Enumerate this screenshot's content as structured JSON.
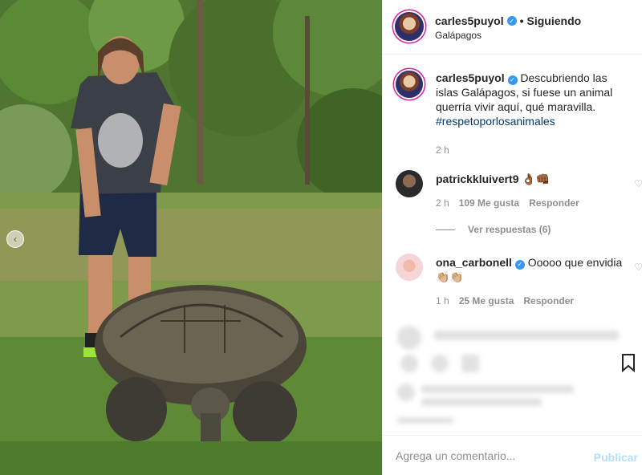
{
  "header": {
    "username": "carles5puyol",
    "follow_label": "Siguiendo",
    "location": "Galápagos"
  },
  "caption": {
    "username": "carles5puyol",
    "text": "Descubriendo las islas Galápagos, si fuese un animal querría vivir aquí, qué maravilla.",
    "hashtag": "#respetoporlosanimales",
    "time": "2 h"
  },
  "comments": [
    {
      "username": "patrickkluivert9",
      "text": "👌🏾👊🏾",
      "time": "2 h",
      "likes": "109 Me gusta",
      "reply": "Responder"
    },
    {
      "username": "ona_carbonell",
      "text": "Ooooo que envidia 👏🏼👏🏼",
      "time": "1 h",
      "likes": "25 Me gusta",
      "reply": "Responder"
    }
  ],
  "replies_label": "Ver respuestas (6)",
  "add_comment": {
    "placeholder": "Agrega un comentario...",
    "publish_label": "Publicar"
  },
  "colors": {
    "verified": "#3897f0",
    "link": "#00376b",
    "publish_disabled": "#b2dffc"
  }
}
